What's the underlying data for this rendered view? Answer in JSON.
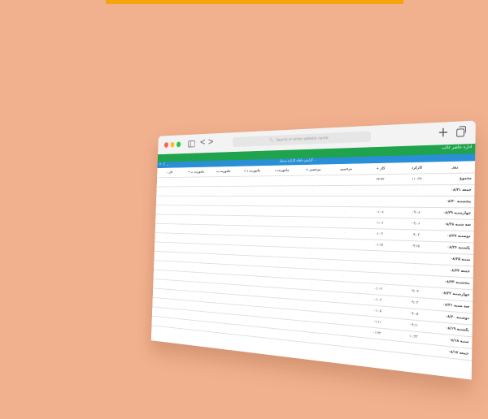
{
  "browser": {
    "search_placeholder": "Search or enter website name",
    "plus": "+",
    "back": "<",
    "forward": ">",
    "icons": [
      "sidebar-icon",
      "back-icon",
      "forward-icon",
      "search-icon",
      "new-tab-icon",
      "tabs-overview-icon"
    ]
  },
  "app_header": {
    "title": "اداره حاضر غائب"
  },
  "dialog": {
    "title": "گزارش ماهانه کارکرد پرسنل ...",
    "controls": "x ▢ _"
  },
  "table": {
    "columns": [
      "روز",
      "کارکرد",
      "کار +",
      "مرخصی",
      "مرخصی +",
      "ماموریت د",
      "ماموریت د +",
      "ماموریت ب",
      "ماموریت ب +",
      "کار -"
    ],
    "rows": [
      {
        "day": "مجموع",
        "cells": [
          "۱۱۰:۳۷",
          "۲۲:۴۲",
          "",
          "",
          "",
          "",
          "",
          "",
          ""
        ]
      },
      {
        "day": "جمعه ۰۸/۳۱",
        "cells": [
          "-",
          "-",
          "-",
          "-",
          "-",
          "-",
          "-",
          "-",
          "-"
        ]
      },
      {
        "day": "پنجشنبه ۰۸/۳۰",
        "cells": [
          "-",
          "-",
          "-",
          "-",
          "-",
          "-",
          "-",
          "-",
          "-"
        ]
      },
      {
        "day": "چهارشنبه ۰۸/۲۹",
        "cells": [
          "۰۹:۰۸",
          "۰۱:۰۸",
          "-",
          "-",
          "-",
          "-",
          "-",
          "-",
          "-"
        ]
      },
      {
        "day": "سه شنبه ۰۸/۲۸",
        "cells": [
          "۰۹:۰۶",
          "۰۱:۰۶",
          "-",
          "-",
          "-",
          "-",
          "-",
          "-",
          "-"
        ]
      },
      {
        "day": "دوشنبه ۰۸/۲۷",
        "cells": [
          "۰۹:۰۳",
          "۰۱:۰۳",
          "-",
          "-",
          "-",
          "-",
          "-",
          "-",
          "-"
        ]
      },
      {
        "day": "یکشنبه ۰۸/۲۶",
        "cells": [
          "۰۹:۱۵",
          "۰۱:۱۵",
          "-",
          "-",
          "-",
          "-",
          "-",
          "-",
          "-"
        ]
      },
      {
        "day": "شنبه ۰۸/۲۵",
        "cells": [
          "-",
          "-",
          "-",
          "-",
          "-",
          "-",
          "-",
          "-",
          "-"
        ]
      },
      {
        "day": "جمعه ۰۸/۲۴",
        "cells": [
          "-",
          "-",
          "-",
          "-",
          "-",
          "-",
          "-",
          "-",
          "-"
        ]
      },
      {
        "day": "پنجشنبه ۰۸/۲۳",
        "cells": [
          "-",
          "-",
          "-",
          "-",
          "-",
          "-",
          "-",
          "-",
          "-"
        ]
      },
      {
        "day": "چهارشنبه ۰۸/۲۲",
        "cells": [
          "۰۹:۰۹",
          "۰۱:۰۹",
          "-",
          "-",
          "-",
          "-",
          "-",
          "-",
          "-"
        ]
      },
      {
        "day": "سه شنبه ۰۸/۲۱",
        "cells": [
          "۰۹:۰۳",
          "۰۱:۰۳",
          "-",
          "-",
          "-",
          "-",
          "-",
          "-",
          "-"
        ]
      },
      {
        "day": "دوشنبه ۰۸/۲۰",
        "cells": [
          "۰۹:۰۵",
          "۰۱:۰۵",
          "-",
          "-",
          "-",
          "-",
          "-",
          "-",
          "-"
        ]
      },
      {
        "day": "یکشنبه ۰۸/۱۹",
        "cells": [
          "۰۹:۱۱",
          "۰۱:۱۱",
          "-",
          "-",
          "-",
          "-",
          "-",
          "-",
          "-"
        ]
      },
      {
        "day": "شنبه ۰۸/۱۸",
        "cells": [
          "۱۰:۳۳",
          "۰۱:۳۳",
          "-",
          "-",
          "-",
          "-",
          "-",
          "-",
          "-"
        ]
      },
      {
        "day": "جمعه ۰۸/۱۷",
        "cells": [
          "-",
          "-",
          "-",
          "-",
          "-",
          "-",
          "-",
          "-",
          "-"
        ]
      }
    ]
  },
  "colors": {
    "background": "#f1b08e",
    "banner": "#f7a30b",
    "app_header": "#1fa34d",
    "dialog_bar": "#2a8fd6"
  }
}
